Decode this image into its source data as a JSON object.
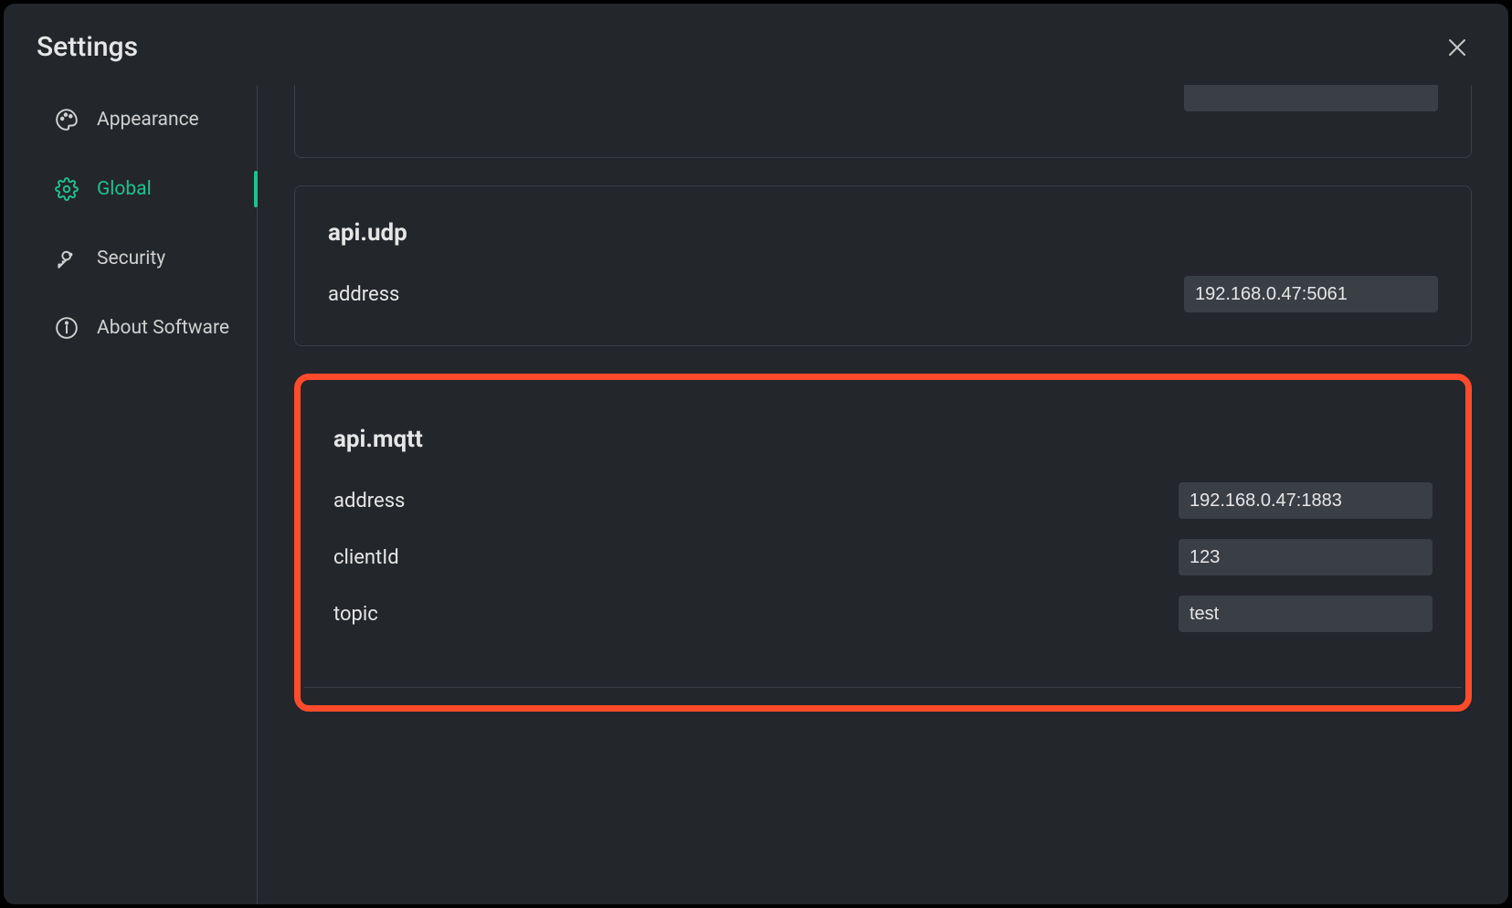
{
  "header": {
    "title": "Settings"
  },
  "sidebar": {
    "items": [
      {
        "key": "appearance",
        "label": "Appearance",
        "icon": "palette-icon",
        "active": false
      },
      {
        "key": "global",
        "label": "Global",
        "icon": "gear-icon",
        "active": true
      },
      {
        "key": "security",
        "label": "Security",
        "icon": "key-icon",
        "active": false
      },
      {
        "key": "about",
        "label": "About Software",
        "icon": "info-icon",
        "active": false
      }
    ]
  },
  "sections": {
    "udp": {
      "title": "api.udp",
      "fields": {
        "address": {
          "label": "address",
          "value": "192.168.0.47:5061"
        }
      }
    },
    "mqtt": {
      "title": "api.mqtt",
      "fields": {
        "address": {
          "label": "address",
          "value": "192.168.0.47:1883"
        },
        "clientId": {
          "label": "clientId",
          "value": "123"
        },
        "topic": {
          "label": "topic",
          "value": "test"
        }
      }
    }
  }
}
